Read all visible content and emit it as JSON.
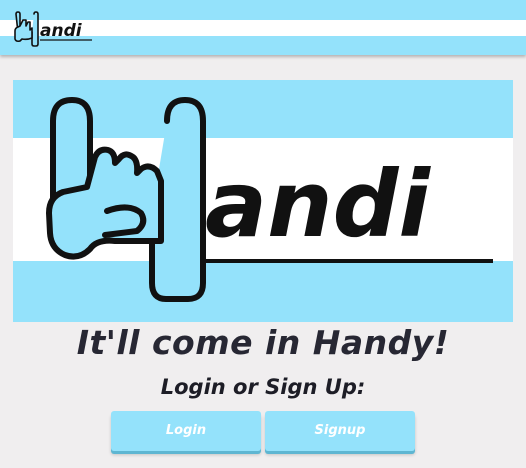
{
  "navbar": {
    "logo_text": "andi",
    "logo_icon": "rock-hand-icon"
  },
  "hero": {
    "logo_text": "andi",
    "logo_icon": "rock-hand-icon"
  },
  "main": {
    "tagline": "It'll come in Handy!",
    "subheading": "Login or Sign Up:"
  },
  "buttons": {
    "login_label": "Login",
    "signup_label": "Signup"
  },
  "colors": {
    "brand_blue": "#94e2fb",
    "background": "#f0eeef",
    "text_dark": "#272733"
  }
}
